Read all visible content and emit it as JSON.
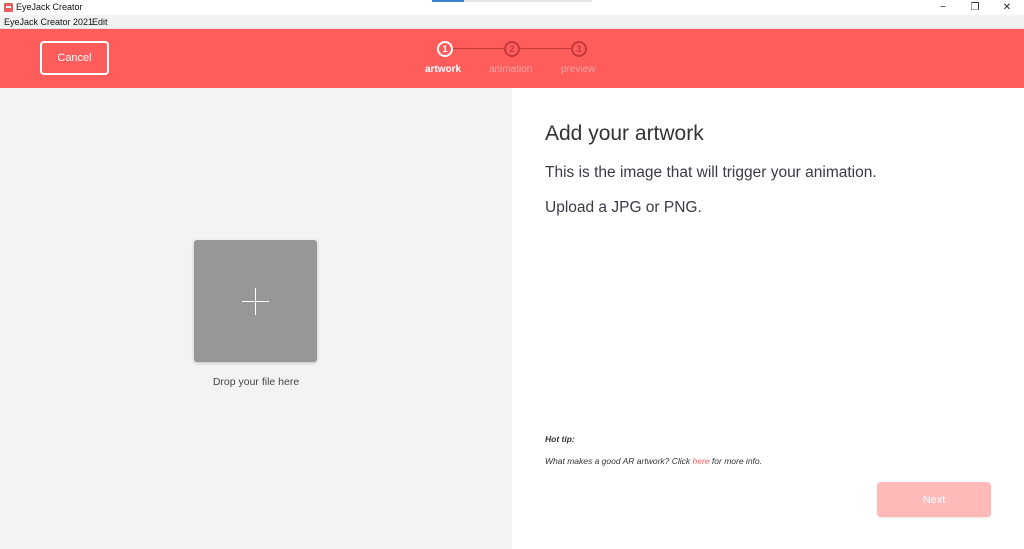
{
  "window": {
    "title": "EyeJack Creator",
    "icon": "eyejack-app-icon",
    "controls": {
      "minimize": "−",
      "maximize": "❐",
      "close": "✕"
    }
  },
  "menu": {
    "items": [
      "EyeJack Creator 2021",
      "Edit"
    ]
  },
  "header": {
    "cancel_label": "Cancel",
    "steps": [
      {
        "number": "1",
        "label": "artwork",
        "active": true
      },
      {
        "number": "2",
        "label": "animation",
        "active": false
      },
      {
        "number": "3",
        "label": "preview",
        "active": false
      }
    ],
    "colors": {
      "background": "#ff5c5c",
      "inactive_step": "#c43a3a"
    }
  },
  "upload": {
    "drop_label": "Drop your file here",
    "icon": "plus-icon"
  },
  "info": {
    "heading": "Add your artwork",
    "line1": "This is the image that will trigger your animation.",
    "line2": "Upload a JPG or PNG.",
    "tip_title": "Hot tip:",
    "tip_before": "What makes a good AR artwork? Click ",
    "tip_link": "here",
    "tip_after": " for more info.",
    "next_label": "Next",
    "colors": {
      "link": "#ff5c5c",
      "next_disabled": "#ffb9b9"
    }
  }
}
